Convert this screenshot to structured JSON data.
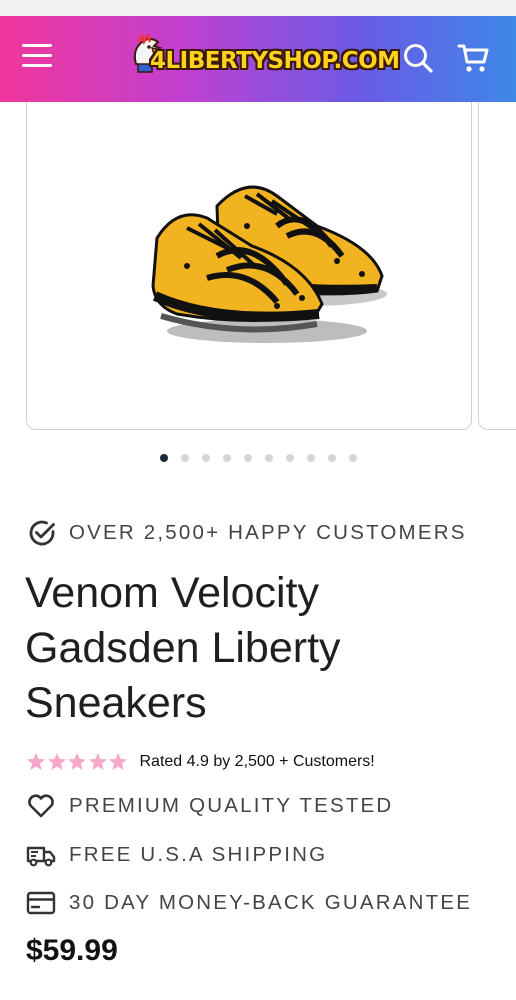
{
  "header": {
    "logo_text": "4LIBERTYSHOP.COM",
    "menu_icon": "hamburger-menu-icon",
    "search_icon": "search-icon",
    "cart_icon": "cart-icon",
    "gradient_colors": [
      "#f0379b",
      "#c23fd0",
      "#6a5be6",
      "#3f87e8"
    ]
  },
  "gallery": {
    "image_alt": "Yellow and black Gadsden sneakers",
    "slide_count": 10,
    "active_slide": 1
  },
  "product": {
    "social_proof": "OVER 2,500+ HAPPY CUSTOMERS",
    "title_lines": [
      "Venom Velocity",
      "Gadsden Liberty",
      "Sneakers"
    ],
    "rating_text": "Rated 4.9 by 2,500 + Customers!",
    "star_count": 5,
    "star_color": "#f7a8c9",
    "features": [
      {
        "icon": "heart-icon",
        "text": "PREMIUM QUALITY TESTED"
      },
      {
        "icon": "truck-icon",
        "text": "FREE U.S.A SHIPPING"
      },
      {
        "icon": "credit-card-icon",
        "text": "30 DAY MONEY-BACK GUARANTEE"
      }
    ],
    "price": "$59.99"
  }
}
